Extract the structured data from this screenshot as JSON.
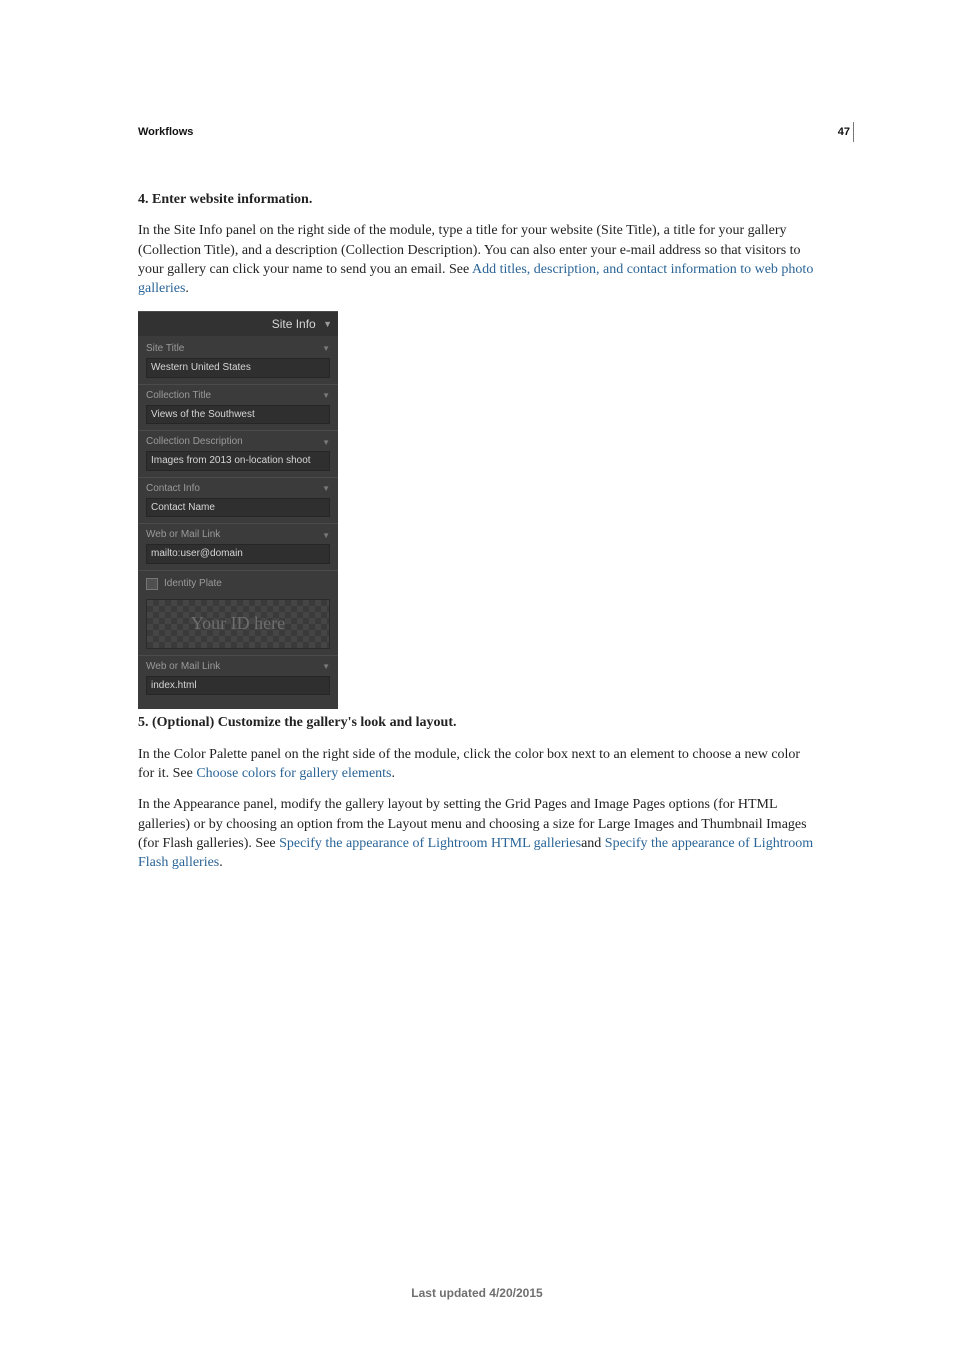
{
  "page": {
    "chapter_header": "Workflows",
    "number": "47",
    "footer": "Last updated 4/20/2015"
  },
  "step4": {
    "heading": "4. Enter website information.",
    "para_1a": "In the Site Info panel on the right side of the module, type a title for your website (Site Title), a title for your gallery (Collection Title), and a description (Collection Description). You can also enter your e-mail address so that visitors to your gallery can click your name to send you an email. See ",
    "link_1": "Add titles, description, and contact information to web photo galleries",
    "para_1b": "."
  },
  "site_info_panel": {
    "title": "Site Info",
    "fields": {
      "site_title": {
        "label": "Site Title",
        "value": "Western United States"
      },
      "collection_title": {
        "label": "Collection Title",
        "value": "Views of the Southwest"
      },
      "collection_description": {
        "label": "Collection Description",
        "value": "Images from 2013 on-location shoot"
      },
      "contact_info": {
        "label": "Contact Info",
        "value": "Contact Name"
      },
      "web_mail_link": {
        "label": "Web or Mail Link",
        "value": "mailto:user@domain"
      },
      "identity_plate": {
        "label": "Identity Plate",
        "placeholder": "Your ID here"
      },
      "identity_link": {
        "label": "Web or Mail Link",
        "value": "index.html"
      }
    }
  },
  "step5": {
    "heading": "5. (Optional) Customize the gallery's look and layout.",
    "para_1a": "In the Color Palette panel on the right side of the module, click the color box next to an element to choose a new color for it. See ",
    "link_1": "Choose colors for gallery elements",
    "para_1b": ".",
    "para_2a": "In the Appearance panel, modify the gallery layout by setting the Grid Pages and Image Pages options (for HTML galleries) or by choosing an option from the Layout menu and choosing a size for Large Images and Thumbnail Images (for Flash galleries). See ",
    "link_2": "Specify the appearance of Lightroom HTML galleries",
    "para_2b": "and ",
    "link_3": "Specify the appearance of Lightroom Flash galleries",
    "para_2c": "."
  }
}
